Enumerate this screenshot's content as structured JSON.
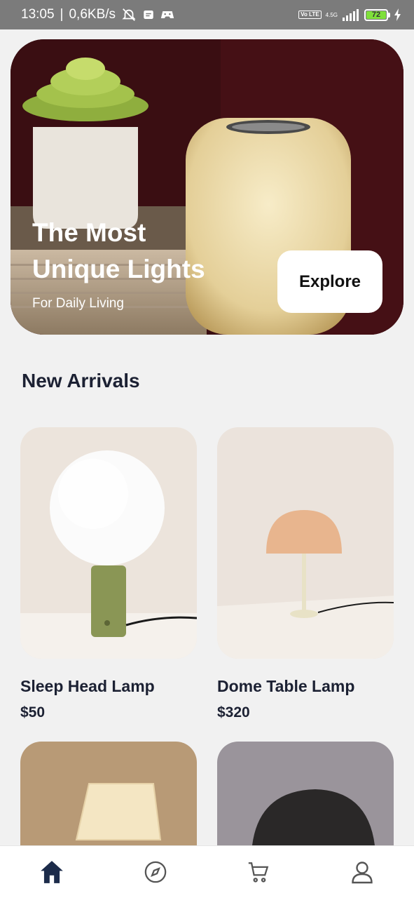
{
  "status_bar": {
    "time": "13:05",
    "net_speed": "0,6KB/s",
    "network_type": "4.5G",
    "volte": "Vo LTE",
    "battery": "72"
  },
  "hero": {
    "title": "The Most\nUnique Lights",
    "subtitle": "For Daily Living",
    "button_label": "Explore"
  },
  "section": {
    "title": "New Arrivals"
  },
  "products": [
    {
      "name": "Sleep Head Lamp",
      "price": "$50"
    },
    {
      "name": "Dome Table Lamp",
      "price": "$320"
    }
  ],
  "bottom_nav": {
    "items": [
      "home-icon",
      "explore-icon",
      "cart-icon",
      "profile-icon"
    ],
    "active_color": "#1c2b4a",
    "inactive_color": "#555555"
  }
}
